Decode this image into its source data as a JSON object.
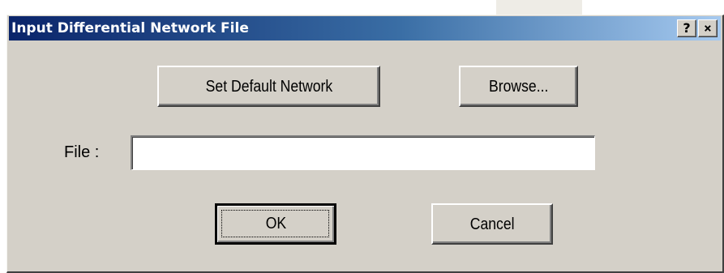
{
  "window": {
    "title": "Input Differential Network File",
    "help_label": "?",
    "close_label": "×"
  },
  "buttons": {
    "set_default_network": "Set Default Network",
    "browse": "Browse...",
    "ok": "OK",
    "cancel": "Cancel"
  },
  "file_field": {
    "label": "File :",
    "value": ""
  },
  "colors": {
    "dialog_face": "#d4d0c8",
    "titlebar_start": "#0a246a",
    "titlebar_end": "#a6caf0"
  }
}
